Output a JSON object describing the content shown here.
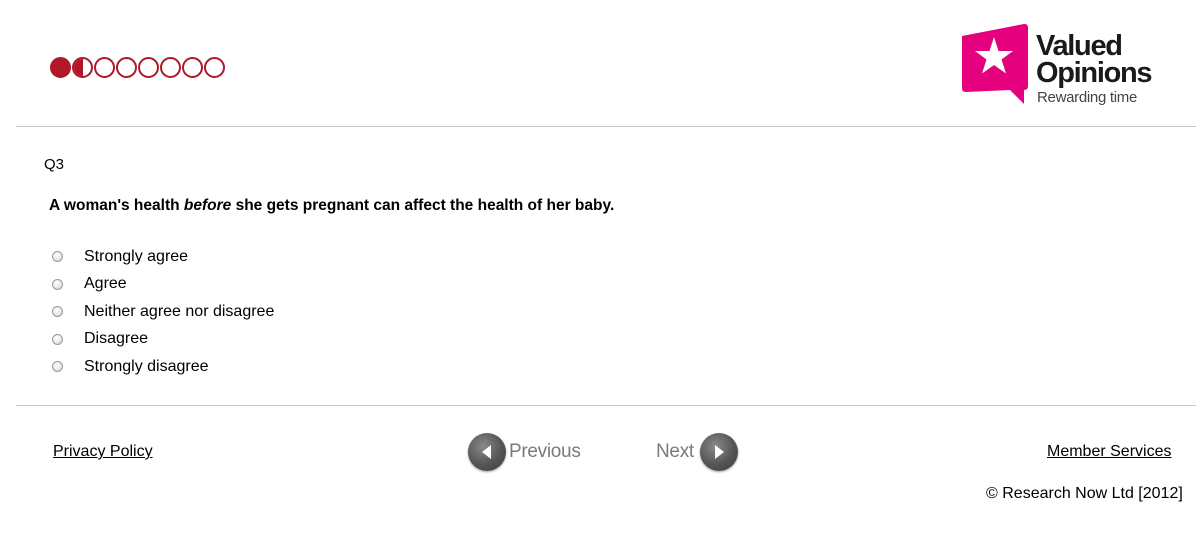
{
  "progress": {
    "total_dots": 8,
    "completed": 1,
    "current": 2
  },
  "logo": {
    "line1": "Valued",
    "line2": "Opinions",
    "tagline": "Rewarding time",
    "brand_color": "#e5007e"
  },
  "question": {
    "number": "Q3",
    "text_before": "A woman's health ",
    "text_emphasis": "before",
    "text_after": " she gets pregnant can affect the health of her baby."
  },
  "options": [
    {
      "label": "Strongly agree",
      "selected": false
    },
    {
      "label": "Agree",
      "selected": false
    },
    {
      "label": "Neither agree nor disagree",
      "selected": false
    },
    {
      "label": "Disagree",
      "selected": false
    },
    {
      "label": "Strongly disagree",
      "selected": false
    }
  ],
  "footer": {
    "privacy_label": "Privacy Policy",
    "previous_label": "Previous",
    "next_label": "Next",
    "member_label": "Member Services",
    "copyright": "© Research Now Ltd [2012]"
  },
  "colors": {
    "progress": "#b0182a",
    "nav_button": "#555555"
  }
}
